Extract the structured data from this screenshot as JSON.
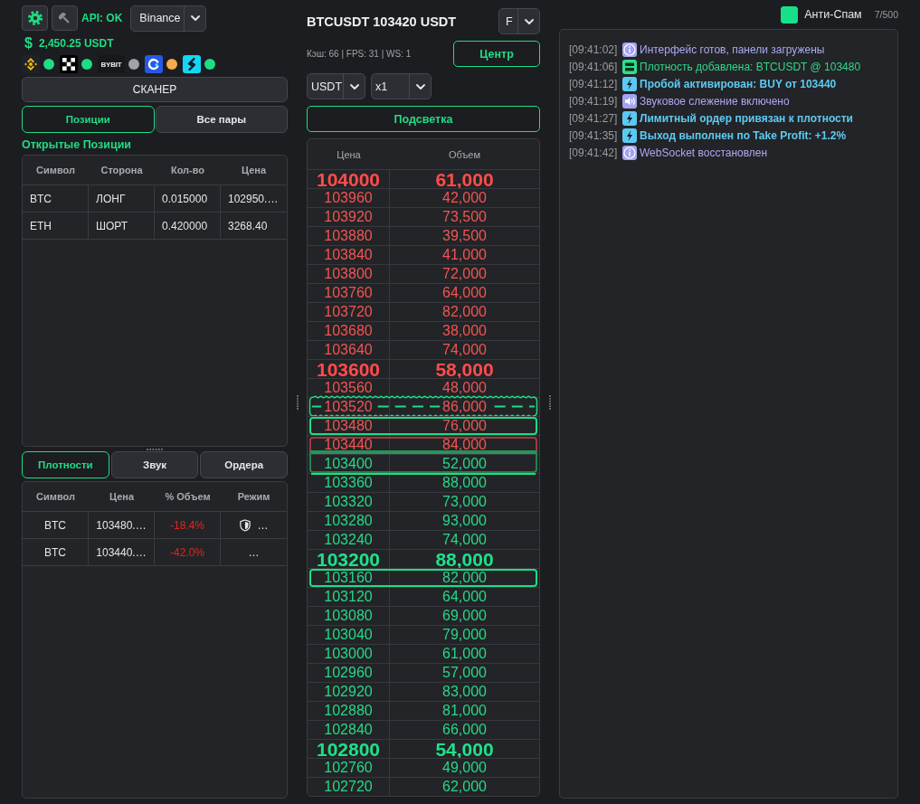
{
  "toolbar": {
    "api_status": "API: OK",
    "exchange": "Binance"
  },
  "balance": {
    "symbol": "$",
    "amount": "2,450.25 USDT"
  },
  "exchanges": [
    {
      "kind": "diamond",
      "color": "#1fdc85"
    },
    {
      "kind": "checker",
      "color": "#1fdc85"
    },
    {
      "kind": "wordmark",
      "label": "BYBIT",
      "color": "#9fa2a7"
    },
    {
      "kind": "ring",
      "color": "#f5ac4b"
    },
    {
      "kind": "swirl",
      "color": "#1fdc85"
    }
  ],
  "scanner_button": "СКАНЕР",
  "left_tabs": [
    {
      "label": "Позиции",
      "selected": true
    },
    {
      "label": "Все пары",
      "selected": false
    }
  ],
  "positions": {
    "heading": "Открытые Позиции",
    "columns": [
      "Символ",
      "Сторона",
      "Кол-во",
      "Цена"
    ],
    "rows": [
      [
        "BTC",
        "ЛОНГ",
        "0.015000",
        "102950.…"
      ],
      [
        "ETH",
        "ШОРТ",
        "0.420000",
        "3268.40"
      ]
    ]
  },
  "lower_tabs": [
    {
      "label": "Плотности",
      "selected": true
    },
    {
      "label": "Звук",
      "selected": false
    },
    {
      "label": "Ордера",
      "selected": false
    }
  ],
  "densities": {
    "columns": [
      "Символ",
      "Цена",
      "% Объем",
      "Режим"
    ],
    "rows": [
      {
        "symbol": "BTC",
        "price": "103480.…",
        "change": "-18.4%",
        "shield": true,
        "mode": "…"
      },
      {
        "symbol": "BTC",
        "price": "103440.…",
        "change": "-42.0%",
        "shield": false,
        "mode": "…"
      }
    ]
  },
  "book_header": {
    "title": "BTCUSDT 103420 USDT",
    "market": "F",
    "stats": "Кэш: 66 | FPS: 31 | WS: 1",
    "center_button": "Центр",
    "quote": "USDT",
    "scale": "x1",
    "highlight_button": "Подсветка"
  },
  "order_book": {
    "columns": [
      "Цена",
      "Объем"
    ],
    "rows": [
      {
        "price": "104000",
        "volume": "61,000",
        "bid": false,
        "major": true,
        "kind": "plain"
      },
      {
        "price": "103960",
        "volume": "42,000",
        "bid": false,
        "major": false,
        "kind": "plain"
      },
      {
        "price": "103920",
        "volume": "73,500",
        "bid": false,
        "major": false,
        "kind": "plain"
      },
      {
        "price": "103880",
        "volume": "39,500",
        "bid": false,
        "major": false,
        "kind": "plain"
      },
      {
        "price": "103840",
        "volume": "41,000",
        "bid": false,
        "major": false,
        "kind": "plain"
      },
      {
        "price": "103800",
        "volume": "72,000",
        "bid": false,
        "major": false,
        "kind": "plain"
      },
      {
        "price": "103760",
        "volume": "64,000",
        "bid": false,
        "major": false,
        "kind": "plain"
      },
      {
        "price": "103720",
        "volume": "82,000",
        "bid": false,
        "major": false,
        "kind": "plain"
      },
      {
        "price": "103680",
        "volume": "38,000",
        "bid": false,
        "major": false,
        "kind": "plain"
      },
      {
        "price": "103640",
        "volume": "74,000",
        "bid": false,
        "major": false,
        "kind": "plain"
      },
      {
        "price": "103600",
        "volume": "58,000",
        "bid": false,
        "major": true,
        "kind": "plain"
      },
      {
        "price": "103560",
        "volume": "48,000",
        "bid": false,
        "major": false,
        "kind": "plain"
      },
      {
        "price": "103520",
        "volume": "86,000",
        "bid": false,
        "major": false,
        "kind": "wavy"
      },
      {
        "price": "103480",
        "volume": "76,000",
        "bid": false,
        "major": false,
        "kind": "outline"
      },
      {
        "price": "103440",
        "volume": "84,000",
        "bid": false,
        "major": false,
        "kind": "zonetop"
      },
      {
        "price": "103400",
        "volume": "52,000",
        "bid": true,
        "major": false,
        "kind": "zonebottom"
      },
      {
        "price": "103360",
        "volume": "88,000",
        "bid": true,
        "major": false,
        "kind": "line"
      },
      {
        "price": "103320",
        "volume": "73,000",
        "bid": true,
        "major": false,
        "kind": "plain"
      },
      {
        "price": "103280",
        "volume": "93,000",
        "bid": true,
        "major": false,
        "kind": "plain"
      },
      {
        "price": "103240",
        "volume": "74,000",
        "bid": true,
        "major": false,
        "kind": "plain"
      },
      {
        "price": "103200",
        "volume": "88,000",
        "bid": true,
        "major": true,
        "kind": "plain"
      },
      {
        "price": "103160",
        "volume": "82,000",
        "bid": true,
        "major": false,
        "kind": "outline"
      },
      {
        "price": "103120",
        "volume": "64,000",
        "bid": true,
        "major": false,
        "kind": "plain"
      },
      {
        "price": "103080",
        "volume": "69,000",
        "bid": true,
        "major": false,
        "kind": "plain"
      },
      {
        "price": "103040",
        "volume": "79,000",
        "bid": true,
        "major": false,
        "kind": "plain"
      },
      {
        "price": "103000",
        "volume": "61,000",
        "bid": true,
        "major": false,
        "kind": "plain"
      },
      {
        "price": "102960",
        "volume": "57,000",
        "bid": true,
        "major": false,
        "kind": "plain"
      },
      {
        "price": "102920",
        "volume": "83,000",
        "bid": true,
        "major": false,
        "kind": "plain"
      },
      {
        "price": "102880",
        "volume": "81,000",
        "bid": true,
        "major": false,
        "kind": "plain"
      },
      {
        "price": "102840",
        "volume": "66,000",
        "bid": true,
        "major": false,
        "kind": "plain"
      },
      {
        "price": "102800",
        "volume": "54,000",
        "bid": true,
        "major": true,
        "kind": "plain"
      },
      {
        "price": "102760",
        "volume": "49,000",
        "bid": true,
        "major": false,
        "kind": "plain"
      },
      {
        "price": "102720",
        "volume": "62,000",
        "bid": true,
        "major": false,
        "kind": "plain"
      }
    ]
  },
  "antispam": {
    "label": "Анти-Спам",
    "checked": true,
    "count": "7/500"
  },
  "log": [
    {
      "time": "[09:41:02]",
      "kind": "info",
      "message": "Интерфейс готов, панели загружены"
    },
    {
      "time": "[09:41:06]",
      "kind": "density",
      "message": "Плотность добавлена: BTCUSDT @ 103480"
    },
    {
      "time": "[09:41:12]",
      "kind": "signal",
      "message": "Пробой активирован: BUY от 103440"
    },
    {
      "time": "[09:41:19]",
      "kind": "sound",
      "message": "Звуковое слежение включено"
    },
    {
      "time": "[09:41:27]",
      "kind": "signal",
      "message": "Лимитный ордер привязан к плотности"
    },
    {
      "time": "[09:41:35]",
      "kind": "signal",
      "message": "Выход выполнен по Take Profit: +1.2%"
    },
    {
      "time": "[09:41:42]",
      "kind": "info",
      "message": "WebSocket восстановлен"
    }
  ]
}
